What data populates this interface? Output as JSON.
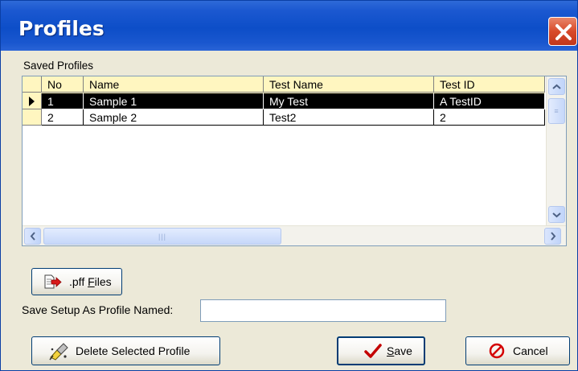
{
  "window": {
    "title": "Profiles"
  },
  "saved_profiles": {
    "label": "Saved Profiles",
    "columns": [
      "No",
      "Name",
      "Test Name",
      "Test ID"
    ],
    "rows": [
      {
        "no": "1",
        "name": "Sample 1",
        "test_name": "My Test",
        "test_id": "A TestID",
        "selected": true
      },
      {
        "no": "2",
        "name": "Sample 2",
        "test_name": "Test2",
        "test_id": "2",
        "selected": false
      }
    ]
  },
  "pff_button": {
    "prefix": ".pff ",
    "mnemonic": "F",
    "rest": "iles"
  },
  "save_as": {
    "label": "Save Setup As Profile Named:",
    "value": ""
  },
  "buttons": {
    "delete": "Delete Selected Profile",
    "save_mnemonic": "S",
    "save_rest": "ave",
    "cancel": "Cancel"
  },
  "icons": {
    "close": "close-icon",
    "pff": "file-export-icon",
    "delete": "eraser-icon",
    "save": "checkmark-icon",
    "cancel": "no-entry-icon"
  },
  "colors": {
    "titlebar": "#0d4ec8",
    "header_bg": "#fff6c0",
    "selected_row": "#000000",
    "window_bg": "#ece9d8",
    "checkmark": "#c40000",
    "cancel": "#d40000"
  }
}
